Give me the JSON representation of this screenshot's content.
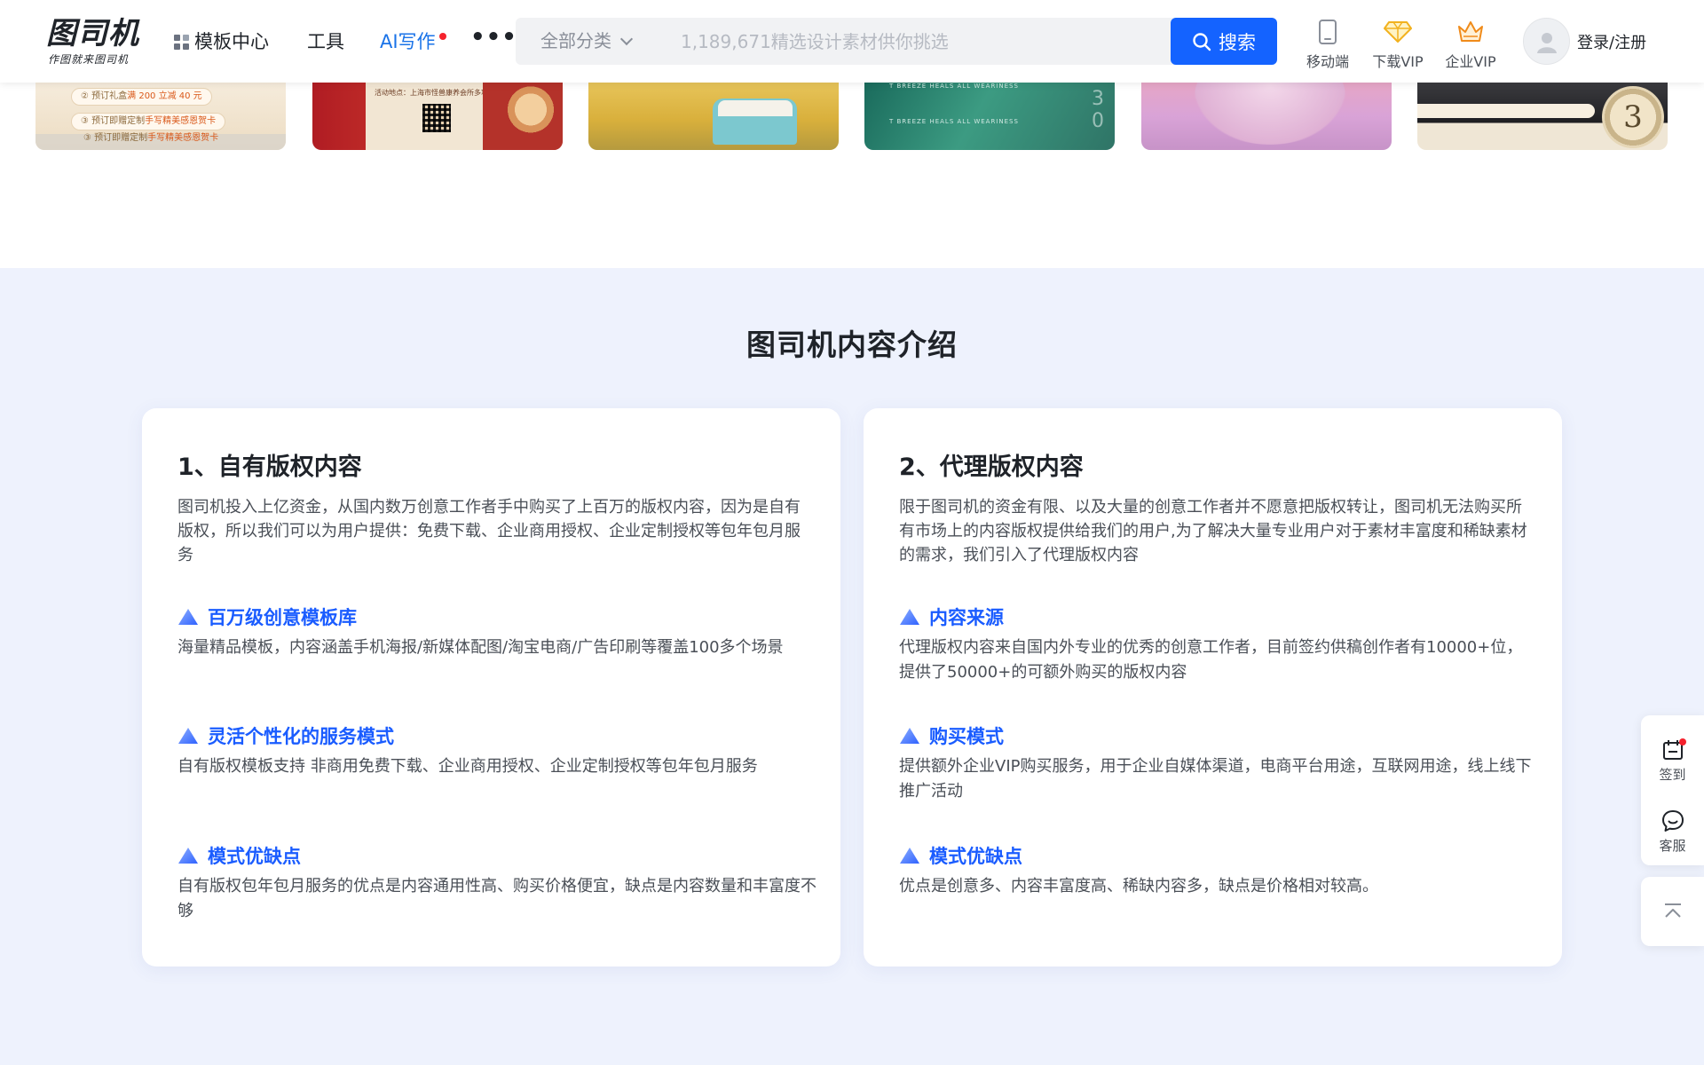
{
  "header": {
    "logo": {
      "name": "图司机",
      "slogan": "作图就来图司机"
    },
    "nav": {
      "templates": "模板中心",
      "tools": "工具",
      "ai_writing": "AI写作",
      "more": "•••"
    },
    "search": {
      "category": "全部分类",
      "placeholder": "1,189,671精选设计素材供你挑选",
      "button": "搜索"
    },
    "actions": {
      "mobile": "移动端",
      "download_vip": "下载VIP",
      "enterprise_vip": "企业VIP"
    },
    "login": "登录/注册"
  },
  "thumbnails": {
    "t1_line1_prefix": "② 预订礼盒",
    "t1_line1_highlight": "满 200 立减 40 元",
    "t1_line2_prefix": "③ 预订即赠定制",
    "t1_line2_highlight": "手写精美感恩贺卡",
    "t1_line3_prefix": "③ 预订即赠定制",
    "t1_line3_highlight": "手写精美感恩贺卡",
    "t2_caption": "活动地点：上海市怪兽康养会所多功能厅",
    "t4_text1": "T BREEZE HEALS ALL WEARINESS",
    "t4_text2": "T BREEZE HEALS ALL WEARINESS",
    "t6_number": "3"
  },
  "intro": {
    "title": "图司机内容介绍",
    "left": {
      "title": "1、自有版权内容",
      "desc": "图司机投入上亿资金，从国内数万创意工作者手中购买了上百万的版权内容，因为是自有版权，所以我们可以为用户提供：免费下载、企业商用授权、企业定制授权等包年包月服务",
      "features": [
        {
          "title": "百万级创意模板库",
          "desc": "海量精品模板，内容涵盖手机海报/新媒体配图/淘宝电商/广告印刷等覆盖100多个场景"
        },
        {
          "title": "灵活个性化的服务模式",
          "desc": "自有版权模板支持 非商用免费下载、企业商用授权、企业定制授权等包年包月服务"
        },
        {
          "title": "模式优缺点",
          "desc": "自有版权包年包月服务的优点是内容通用性高、购买价格便宜，缺点是内容数量和丰富度不够"
        }
      ]
    },
    "right": {
      "title": "2、代理版权内容",
      "desc": "限于图司机的资金有限、以及大量的创意工作者并不愿意把版权转让，图司机无法购买所有市场上的内容版权提供给我们的用户,为了解决大量专业用户对于素材丰富度和稀缺素材的需求，我们引入了代理版权内容",
      "features": [
        {
          "title": "内容来源",
          "desc": "代理版权内容来自国内外专业的优秀的创意工作者，目前签约供稿创作者有10000+位，提供了50000+的可额外购买的版权内容"
        },
        {
          "title": "购买模式",
          "desc": "提供额外企业VIP购买服务，用于企业自媒体渠道，电商平台用途，互联网用途，线上线下推广活动"
        },
        {
          "title": "模式优缺点",
          "desc": "优点是创意多、内容丰富度高、稀缺内容多，缺点是价格相对较高。"
        }
      ]
    }
  },
  "sidebar": {
    "checkin": "签到",
    "service": "客服"
  },
  "colors": {
    "brand_blue": "#1463ff",
    "feature_blue": "#1a5cff",
    "section_bg": "#eef2fd",
    "red_dot": "#f5222d"
  },
  "icons": {
    "templates": "grid-icon",
    "search": "search-icon",
    "mobile": "phone-icon",
    "vip": "diamond-icon",
    "enterprise": "crown-icon",
    "avatar": "user-icon",
    "feature": "triangle-icon",
    "checkin": "calendar-icon",
    "service": "chat-icon",
    "top": "back-to-top-icon"
  }
}
